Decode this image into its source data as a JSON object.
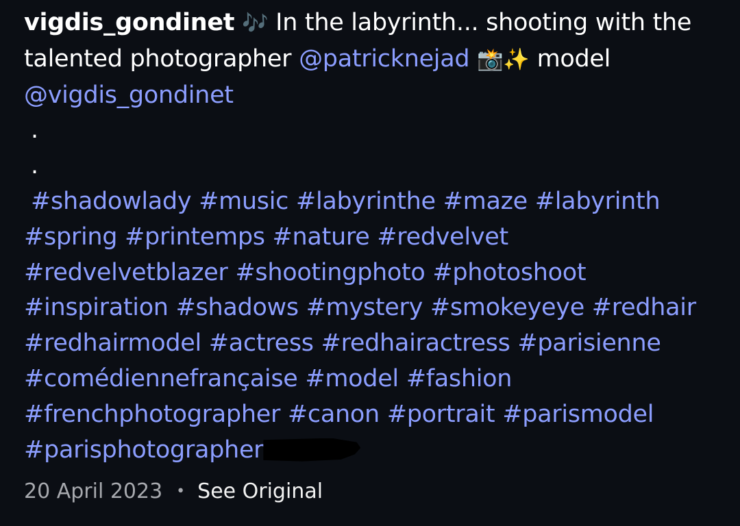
{
  "post": {
    "username": "vigdis_gondinet",
    "emoji_notes": "🎶",
    "caption_text_1": "In the labyrinth... shooting with the",
    "caption_text_2": "talented photographer",
    "mention_photographer": "@patricknejad",
    "emoji_camera_sparkle": "📸✨",
    "caption_text_3": "model",
    "mention_model": "@vigdis_gondinet",
    "dot": "."
  },
  "hashtags": {
    "line1": [
      "#shadowlady",
      "#music",
      "#labyrinthe",
      "#maze",
      "#labyrinth"
    ],
    "line2": [
      "#spring",
      "#printemps",
      "#nature",
      "#redvelvet"
    ],
    "line3": [
      "#redvelvetblazer",
      "#shootingphoto",
      "#photoshoot"
    ],
    "line4": [
      "#inspiration",
      "#shadows",
      "#mystery",
      "#smokeyeye",
      "#redhair"
    ],
    "line5": [
      "#redhairmodel",
      "#actress",
      "#redhairactress",
      "#parisienne"
    ],
    "line6": [
      "#comédiennefrançaise",
      "#model",
      "#fashion"
    ],
    "line7": [
      "#frenchphotographer",
      "#canon",
      "#portrait",
      "#parismodel"
    ],
    "line8": [
      "#parisphotographer"
    ]
  },
  "footer": {
    "date": "20 April 2023",
    "separator": "•",
    "see_original_label": "See Original"
  },
  "colors": {
    "background": "#0b0e14",
    "link": "#8c9eff",
    "date": "#a7a9ae"
  }
}
